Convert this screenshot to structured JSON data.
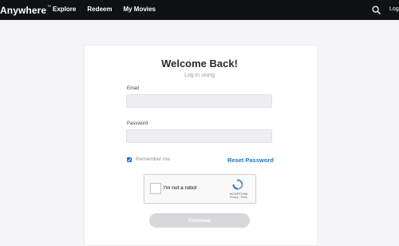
{
  "header": {
    "brand": "Anywhere",
    "brand_mark": "™",
    "nav": [
      "Explore",
      "Redeem",
      "My Movies"
    ],
    "truncated_right_link": "Log"
  },
  "login": {
    "title": "Welcome Back!",
    "subtitle": "Log in using",
    "email_label": "Email",
    "email_value": "",
    "password_label": "Password",
    "password_value": "",
    "remember_me": "Remember me",
    "remember_me_checked": true,
    "reset_password": "Reset Password",
    "continue": "Continue"
  },
  "recaptcha": {
    "prompt": "I'm not a robot",
    "brand": "reCAPTCHA",
    "links": "Privacy - Terms"
  },
  "colors": {
    "topbar": "#0f1115",
    "link_blue": "#1479c8",
    "checkbox_blue": "#1a73e8",
    "button_disabled": "#d8d8db"
  },
  "icons": {
    "search": "search-icon",
    "checkbox": "checkbox-checked-icon",
    "recaptcha": "recaptcha-logo-icon"
  }
}
